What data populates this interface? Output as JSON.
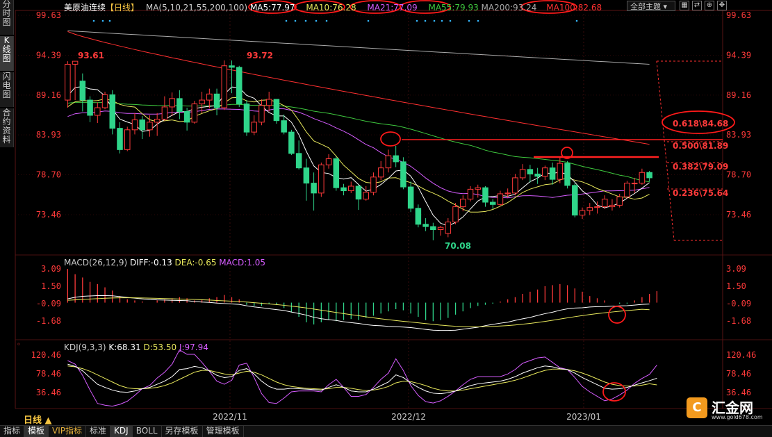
{
  "side_tabs": [
    "分时图",
    "K线图",
    "闪电图",
    "合约资料"
  ],
  "active_side_tab": 1,
  "header": {
    "title": "美原油连续",
    "period": "【日线】",
    "ma_label": "MA(5,10,21,55,200,100)",
    "ma5": "MA5:77.97",
    "ma10": "MA10:76.28",
    "ma21": "MA21:77.09",
    "ma55": "MA55:79.93",
    "ma200": "MA200:93.24",
    "ma100": "MA100:82.68",
    "theme": "全部主题"
  },
  "macd_header": {
    "label": "MACD(26,12,9)",
    "diff": "DIFF:-0.13",
    "dea": "DEA:-0.65",
    "macd": "MACD:1.05"
  },
  "kdj_header": {
    "label": "KDJ(9,3,3)",
    "k": "K:68.31",
    "d": "D:53.50",
    "j": "J:97.94"
  },
  "bottom_tabs": [
    "指标",
    "模板",
    "VIP指标",
    "标准",
    "KDJ",
    "BOLL",
    "另存模板",
    "管理模板"
  ],
  "active_bottom_tabs": [
    "模板",
    "KDJ"
  ],
  "period_label": "日线 ▲",
  "logo": {
    "name": "汇金网",
    "url": "www.gold678.com"
  },
  "colors": {
    "up": "#ff3a3a",
    "down": "#2fd58a",
    "ma5": "#ffffff",
    "ma10": "#e8e85c",
    "ma21": "#d65cff",
    "ma55": "#3ec83e",
    "ma200": "#aaaaaa",
    "ma100": "#ff3030",
    "axis": "#ff3a3a"
  },
  "chart_data": {
    "type": "candlestick",
    "price_axis": [
      "99.63",
      "94.39",
      "89.16",
      "83.93",
      "78.70",
      "73.46"
    ],
    "macd_axis": [
      "3.09",
      "1.50",
      "-0.09",
      "-1.68"
    ],
    "kdj_axis": [
      "120.46",
      "78.46",
      "36.46"
    ],
    "x_labels": [
      "2022/11",
      "2022/12",
      "2023/01"
    ],
    "annotations": {
      "high1": "93.61",
      "high2": "93.72",
      "low": "70.08"
    },
    "fibonacci": [
      "0.618\\84.68",
      "0.500\\81.89",
      "0.382\\79.09",
      "0.236\\75.64"
    ],
    "candles": [
      [
        88.5,
        93.2,
        87.5,
        93.6
      ],
      [
        93.2,
        93.6,
        88.5,
        93.6
      ],
      [
        91.0,
        88.5,
        87.0,
        92.0
      ],
      [
        88.5,
        86.5,
        85.6,
        89.0
      ],
      [
        86.5,
        87.5,
        85.5,
        88.2
      ],
      [
        87.5,
        89.2,
        87.3,
        89.6
      ],
      [
        89.2,
        84.8,
        84.0,
        89.8
      ],
      [
        84.8,
        82.0,
        81.5,
        85.6
      ],
      [
        82.0,
        84.6,
        81.8,
        85.0
      ],
      [
        84.6,
        85.9,
        84.0,
        86.8
      ],
      [
        85.9,
        84.6,
        83.4,
        86.4
      ],
      [
        84.6,
        85.6,
        83.7,
        86.5
      ],
      [
        85.6,
        86.0,
        83.8,
        86.8
      ],
      [
        86.0,
        87.6,
        85.8,
        89.0
      ],
      [
        87.6,
        88.7,
        86.4,
        89.5
      ],
      [
        88.7,
        87.0,
        86.0,
        89.8
      ],
      [
        87.0,
        85.6,
        84.5,
        87.5
      ],
      [
        85.6,
        88.0,
        85.4,
        88.4
      ],
      [
        88.0,
        88.5,
        86.8,
        89.6
      ],
      [
        88.5,
        89.3,
        87.4,
        90.0
      ],
      [
        89.3,
        87.5,
        86.5,
        90.0
      ],
      [
        87.5,
        93.0,
        87.2,
        93.7
      ],
      [
        93.0,
        92.8,
        89.4,
        93.7
      ],
      [
        92.8,
        88.0,
        87.6,
        93.0
      ],
      [
        88.0,
        84.3,
        83.8,
        88.5
      ],
      [
        84.3,
        85.6,
        83.9,
        86.5
      ],
      [
        85.6,
        87.8,
        85.2,
        88.6
      ],
      [
        87.8,
        88.6,
        87.0,
        89.6
      ],
      [
        88.6,
        85.8,
        85.4,
        88.6
      ],
      [
        85.8,
        84.3,
        84.0,
        86.6
      ],
      [
        84.3,
        81.5,
        81.3,
        84.6
      ],
      [
        81.5,
        79.6,
        79.4,
        83.2
      ],
      [
        79.6,
        77.6,
        75.3,
        80.8
      ],
      [
        77.6,
        76.3,
        74.0,
        79.0
      ],
      [
        76.3,
        80.0,
        75.8,
        80.3
      ],
      [
        80.0,
        80.8,
        79.5,
        81.4
      ],
      [
        80.8,
        77.0,
        76.6,
        81.1
      ],
      [
        77.0,
        76.6,
        76.0,
        77.5
      ],
      [
        76.6,
        77.2,
        76.3,
        77.8
      ],
      [
        77.2,
        75.5,
        74.1,
        77.4
      ],
      [
        75.5,
        76.4,
        75.3,
        77.2
      ],
      [
        76.4,
        78.4,
        76.0,
        79.0
      ],
      [
        78.4,
        79.6,
        78.0,
        80.5
      ],
      [
        79.6,
        81.2,
        79.0,
        82.0
      ],
      [
        81.2,
        80.4,
        79.7,
        82.5
      ],
      [
        80.4,
        77.1,
        76.8,
        81.0
      ],
      [
        77.1,
        74.3,
        73.8,
        77.8
      ],
      [
        74.3,
        72.2,
        71.8,
        74.8
      ],
      [
        72.2,
        71.9,
        71.3,
        73.0
      ],
      [
        71.9,
        71.5,
        70.1,
        72.4
      ],
      [
        71.5,
        71.8,
        70.7,
        72.0
      ],
      [
        71.0,
        72.5,
        70.5,
        73.0
      ],
      [
        72.5,
        74.5,
        72.2,
        75.0
      ],
      [
        74.5,
        75.5,
        73.9,
        76.0
      ],
      [
        75.5,
        76.8,
        75.2,
        77.2
      ],
      [
        76.8,
        77.0,
        75.7,
        77.4
      ],
      [
        77.0,
        75.1,
        74.5,
        77.2
      ],
      [
        75.1,
        74.8,
        74.2,
        75.5
      ],
      [
        74.8,
        76.2,
        74.6,
        76.6
      ],
      [
        76.2,
        76.3,
        75.7,
        76.9
      ],
      [
        76.3,
        78.3,
        76.0,
        78.8
      ],
      [
        78.3,
        79.4,
        78.0,
        80.1
      ],
      [
        79.4,
        78.8,
        77.7,
        80.0
      ],
      [
        78.8,
        78.5,
        77.5,
        79.6
      ],
      [
        78.5,
        79.6,
        78.0,
        79.9
      ],
      [
        79.6,
        78.1,
        77.4,
        80.3
      ],
      [
        78.1,
        80.2,
        77.6,
        81.0
      ],
      [
        80.2,
        77.3,
        76.9,
        80.5
      ],
      [
        77.3,
        73.4,
        73.1,
        77.6
      ],
      [
        73.4,
        74.0,
        72.9,
        74.4
      ],
      [
        74.0,
        74.4,
        73.4,
        75.0
      ],
      [
        74.4,
        74.5,
        73.6,
        75.2
      ],
      [
        74.5,
        75.5,
        74.2,
        76.0
      ],
      [
        74.5,
        74.7,
        74.0,
        75.5
      ],
      [
        74.7,
        75.8,
        74.4,
        76.2
      ],
      [
        75.8,
        77.6,
        75.6,
        77.9
      ],
      [
        77.6,
        77.6,
        76.3,
        78.3
      ],
      [
        77.6,
        79.0,
        77.4,
        79.5
      ],
      [
        79.0,
        78.3,
        77.8,
        79.2
      ]
    ],
    "macd_hist": [
      3.09,
      2.6,
      2.3,
      1.9,
      1.7,
      1.4,
      1.1,
      0.6,
      0.3,
      0.2,
      0.1,
      0.0,
      0.2,
      0.3,
      0.4,
      0.5,
      0.4,
      0.2,
      0.3,
      0.4,
      0.5,
      0.7,
      0.5,
      0.3,
      -0.2,
      -0.3,
      -0.3,
      -0.1,
      -0.2,
      -0.5,
      -0.9,
      -1.3,
      -1.8,
      -2.0,
      -1.8,
      -1.6,
      -1.7,
      -1.6,
      -1.5,
      -1.6,
      -1.4,
      -1.2,
      -1.0,
      -0.8,
      -0.6,
      -0.7,
      -1.0,
      -1.3,
      -1.6,
      -1.7,
      -1.6,
      -1.4,
      -1.1,
      -0.8,
      -0.5,
      -0.3,
      -0.2,
      -0.1,
      0.1,
      0.3,
      0.5,
      0.8,
      1.0,
      1.2,
      1.5,
      1.6,
      1.7,
      1.6,
      1.3,
      1.0,
      0.6,
      0.4,
      0.2,
      0.0,
      -0.1,
      -0.1,
      0.2,
      0.5,
      0.8,
      1.05
    ],
    "kdj_k": [
      100,
      95,
      85,
      70,
      55,
      48,
      42,
      38,
      37,
      40,
      45,
      48,
      55,
      62,
      72,
      88,
      90,
      95,
      92,
      85,
      75,
      70,
      72,
      86,
      90,
      78,
      62,
      50,
      44,
      44,
      46,
      45,
      44,
      43,
      42,
      48,
      54,
      48,
      40,
      38,
      38,
      44,
      52,
      60,
      76,
      70,
      58,
      48,
      40,
      35,
      34,
      36,
      40,
      46,
      52,
      56,
      58,
      60,
      62,
      66,
      72,
      80,
      86,
      92,
      96,
      94,
      90,
      88,
      80,
      70,
      62,
      54,
      46,
      44,
      45,
      48,
      53,
      58,
      63,
      68.31
    ],
    "kdj_d": [
      96,
      94,
      90,
      84,
      76,
      68,
      60,
      52,
      47,
      45,
      45,
      46,
      48,
      52,
      58,
      66,
      74,
      82,
      86,
      86,
      82,
      78,
      76,
      80,
      84,
      82,
      76,
      68,
      60,
      54,
      50,
      48,
      46,
      45,
      44,
      45,
      48,
      48,
      46,
      43,
      41,
      42,
      45,
      50,
      58,
      62,
      61,
      57,
      52,
      46,
      42,
      40,
      40,
      42,
      45,
      48,
      51,
      54,
      57,
      60,
      64,
      69,
      75,
      81,
      86,
      89,
      89,
      88,
      85,
      80,
      74,
      67,
      60,
      55,
      52,
      51,
      51,
      53,
      56,
      53.5
    ],
    "kdj_j": [
      108,
      100,
      75,
      42,
      12,
      8,
      6,
      10,
      17,
      30,
      45,
      52,
      69,
      82,
      100,
      132,
      122,
      122,
      104,
      84,
      62,
      55,
      64,
      98,
      102,
      70,
      34,
      14,
      12,
      24,
      38,
      40,
      40,
      40,
      38,
      54,
      66,
      48,
      28,
      28,
      32,
      48,
      66,
      80,
      112,
      86,
      52,
      30,
      16,
      13,
      18,
      28,
      40,
      54,
      66,
      72,
      72,
      72,
      72,
      78,
      88,
      102,
      108,
      114,
      116,
      104,
      92,
      88,
      70,
      50,
      38,
      28,
      18,
      22,
      31,
      42,
      57,
      68,
      77,
      97.94
    ]
  }
}
